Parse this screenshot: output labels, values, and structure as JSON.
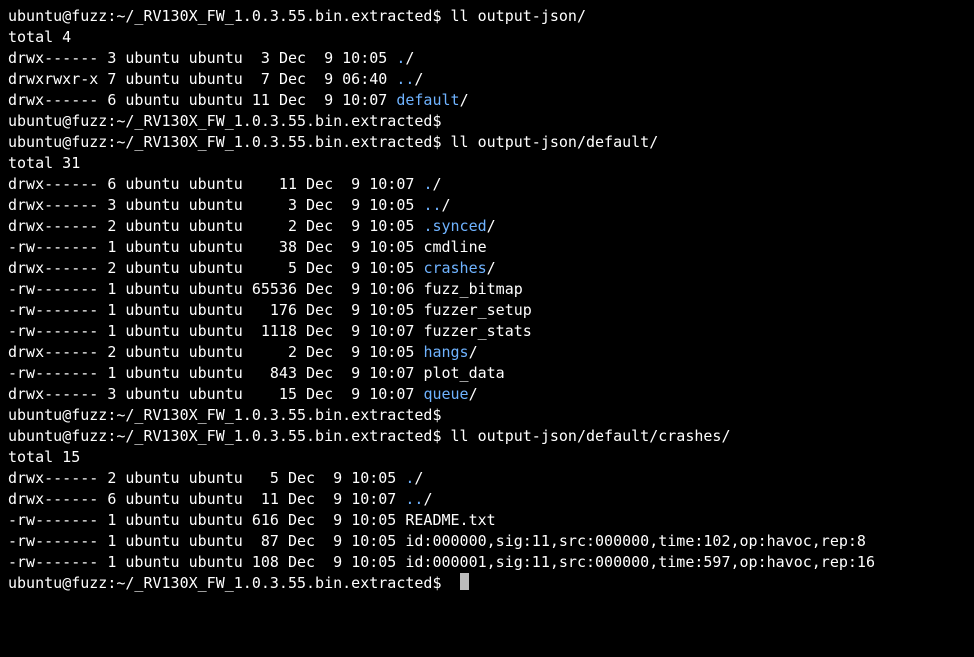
{
  "prompt": {
    "user": "ubuntu",
    "host": "fuzz",
    "path": "~/_RV130X_FW_1.0.3.55.bin.extracted",
    "dollar": "$"
  },
  "blocks": [
    {
      "cmd": "ll output-json/",
      "total": "total 4",
      "rows": [
        {
          "perm": "drwx------",
          "links": "3",
          "owner": "ubuntu",
          "group": "ubuntu",
          "size": "3",
          "month": "Dec",
          "day": "9",
          "time": "10:05",
          "name": "./",
          "dir": true
        },
        {
          "perm": "drwxrwxr-x",
          "links": "7",
          "owner": "ubuntu",
          "group": "ubuntu",
          "size": "7",
          "month": "Dec",
          "day": "9",
          "time": "06:40",
          "name": "../",
          "dir": true
        },
        {
          "perm": "drwx------",
          "links": "6",
          "owner": "ubuntu",
          "group": "ubuntu",
          "size": "11",
          "month": "Dec",
          "day": "9",
          "time": "10:07",
          "name": "default/",
          "dir": true,
          "colorName": "default"
        }
      ],
      "sizeWidth": 2
    },
    {
      "cmd": ""
    },
    {
      "cmd": "ll output-json/default/",
      "total": "total 31",
      "rows": [
        {
          "perm": "drwx------",
          "links": "6",
          "owner": "ubuntu",
          "group": "ubuntu",
          "size": "11",
          "month": "Dec",
          "day": "9",
          "time": "10:07",
          "name": "./",
          "dir": true
        },
        {
          "perm": "drwx------",
          "links": "3",
          "owner": "ubuntu",
          "group": "ubuntu",
          "size": "3",
          "month": "Dec",
          "day": "9",
          "time": "10:05",
          "name": "../",
          "dir": true
        },
        {
          "perm": "drwx------",
          "links": "2",
          "owner": "ubuntu",
          "group": "ubuntu",
          "size": "2",
          "month": "Dec",
          "day": "9",
          "time": "10:05",
          "name": ".synced/",
          "dir": true,
          "colorName": ".synced"
        },
        {
          "perm": "-rw-------",
          "links": "1",
          "owner": "ubuntu",
          "group": "ubuntu",
          "size": "38",
          "month": "Dec",
          "day": "9",
          "time": "10:05",
          "name": "cmdline",
          "dir": false
        },
        {
          "perm": "drwx------",
          "links": "2",
          "owner": "ubuntu",
          "group": "ubuntu",
          "size": "5",
          "month": "Dec",
          "day": "9",
          "time": "10:05",
          "name": "crashes/",
          "dir": true,
          "colorName": "crashes"
        },
        {
          "perm": "-rw-------",
          "links": "1",
          "owner": "ubuntu",
          "group": "ubuntu",
          "size": "65536",
          "month": "Dec",
          "day": "9",
          "time": "10:06",
          "name": "fuzz_bitmap",
          "dir": false
        },
        {
          "perm": "-rw-------",
          "links": "1",
          "owner": "ubuntu",
          "group": "ubuntu",
          "size": "176",
          "month": "Dec",
          "day": "9",
          "time": "10:05",
          "name": "fuzzer_setup",
          "dir": false
        },
        {
          "perm": "-rw-------",
          "links": "1",
          "owner": "ubuntu",
          "group": "ubuntu",
          "size": "1118",
          "month": "Dec",
          "day": "9",
          "time": "10:07",
          "name": "fuzzer_stats",
          "dir": false
        },
        {
          "perm": "drwx------",
          "links": "2",
          "owner": "ubuntu",
          "group": "ubuntu",
          "size": "2",
          "month": "Dec",
          "day": "9",
          "time": "10:05",
          "name": "hangs/",
          "dir": true,
          "colorName": "hangs"
        },
        {
          "perm": "-rw-------",
          "links": "1",
          "owner": "ubuntu",
          "group": "ubuntu",
          "size": "843",
          "month": "Dec",
          "day": "9",
          "time": "10:07",
          "name": "plot_data",
          "dir": false
        },
        {
          "perm": "drwx------",
          "links": "3",
          "owner": "ubuntu",
          "group": "ubuntu",
          "size": "15",
          "month": "Dec",
          "day": "9",
          "time": "10:07",
          "name": "queue/",
          "dir": true,
          "colorName": "queue"
        }
      ],
      "sizeWidth": 5
    },
    {
      "cmd": ""
    },
    {
      "cmd": "ll output-json/default/crashes/",
      "total": "total 15",
      "rows": [
        {
          "perm": "drwx------",
          "links": "2",
          "owner": "ubuntu",
          "group": "ubuntu",
          "size": "5",
          "month": "Dec",
          "day": "9",
          "time": "10:05",
          "name": "./",
          "dir": true
        },
        {
          "perm": "drwx------",
          "links": "6",
          "owner": "ubuntu",
          "group": "ubuntu",
          "size": "11",
          "month": "Dec",
          "day": "9",
          "time": "10:07",
          "name": "../",
          "dir": true
        },
        {
          "perm": "-rw-------",
          "links": "1",
          "owner": "ubuntu",
          "group": "ubuntu",
          "size": "616",
          "month": "Dec",
          "day": "9",
          "time": "10:05",
          "name": "README.txt",
          "dir": false
        },
        {
          "perm": "-rw-------",
          "links": "1",
          "owner": "ubuntu",
          "group": "ubuntu",
          "size": "87",
          "month": "Dec",
          "day": "9",
          "time": "10:05",
          "name": "id:000000,sig:11,src:000000,time:102,op:havoc,rep:8",
          "dir": false
        },
        {
          "perm": "-rw-------",
          "links": "1",
          "owner": "ubuntu",
          "group": "ubuntu",
          "size": "108",
          "month": "Dec",
          "day": "9",
          "time": "10:05",
          "name": "id:000001,sig:11,src:000000,time:597,op:havoc,rep:16",
          "dir": false
        }
      ],
      "sizeWidth": 3
    },
    {
      "cmd": "",
      "cursor": true
    }
  ]
}
